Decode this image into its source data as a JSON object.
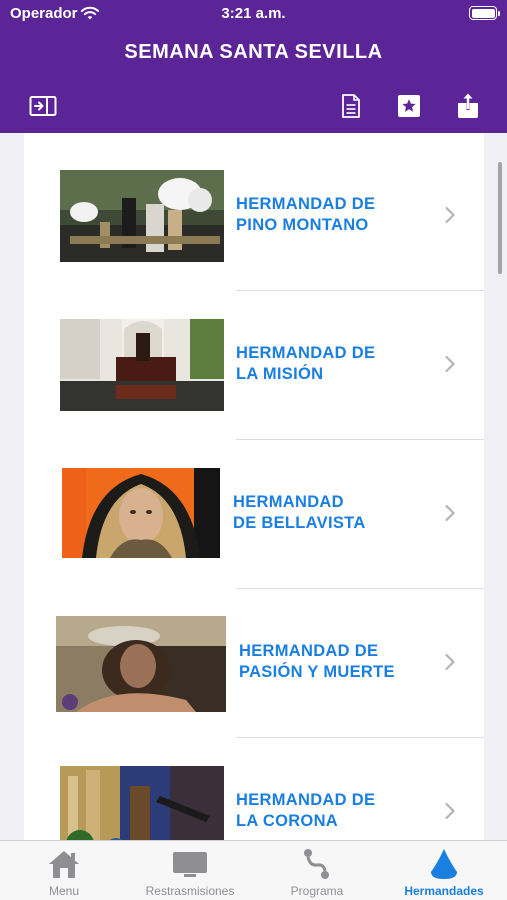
{
  "status_bar": {
    "carrier": "Operador",
    "time": "3:21 a.m."
  },
  "header": {
    "title": "SEMANA SANTA SEVILLA"
  },
  "toolbar": {
    "left_icon": "sidebar-toggle-icon",
    "right_icons": [
      "document-icon",
      "star-icon",
      "share-icon"
    ]
  },
  "hermandades": [
    {
      "name": "HERMANDAD DE\nPINO MONTANO",
      "icon": "chevron-right-icon"
    },
    {
      "name": "HERMANDAD DE\nLA MISIÓN",
      "icon": "chevron-right-icon"
    },
    {
      "name": "HERMANDAD\nDE BELLAVISTA",
      "icon": "chevron-right-icon"
    },
    {
      "name": "HERMANDAD DE\nPASIÓN Y MUERTE",
      "icon": "chevron-right-icon"
    },
    {
      "name": "HERMANDAD DE\nLA CORONA",
      "icon": "chevron-right-icon"
    }
  ],
  "tabbar": {
    "tabs": [
      {
        "label": "Menu",
        "icon": "home-icon"
      },
      {
        "label": "Restrasmisiones",
        "icon": "tv-icon"
      },
      {
        "label": "Programa",
        "icon": "route-icon"
      },
      {
        "label": "Hermandades",
        "icon": "drop-icon",
        "active": true
      }
    ]
  },
  "colors": {
    "accent": "#5b2597",
    "link": "#1a7fe0"
  }
}
